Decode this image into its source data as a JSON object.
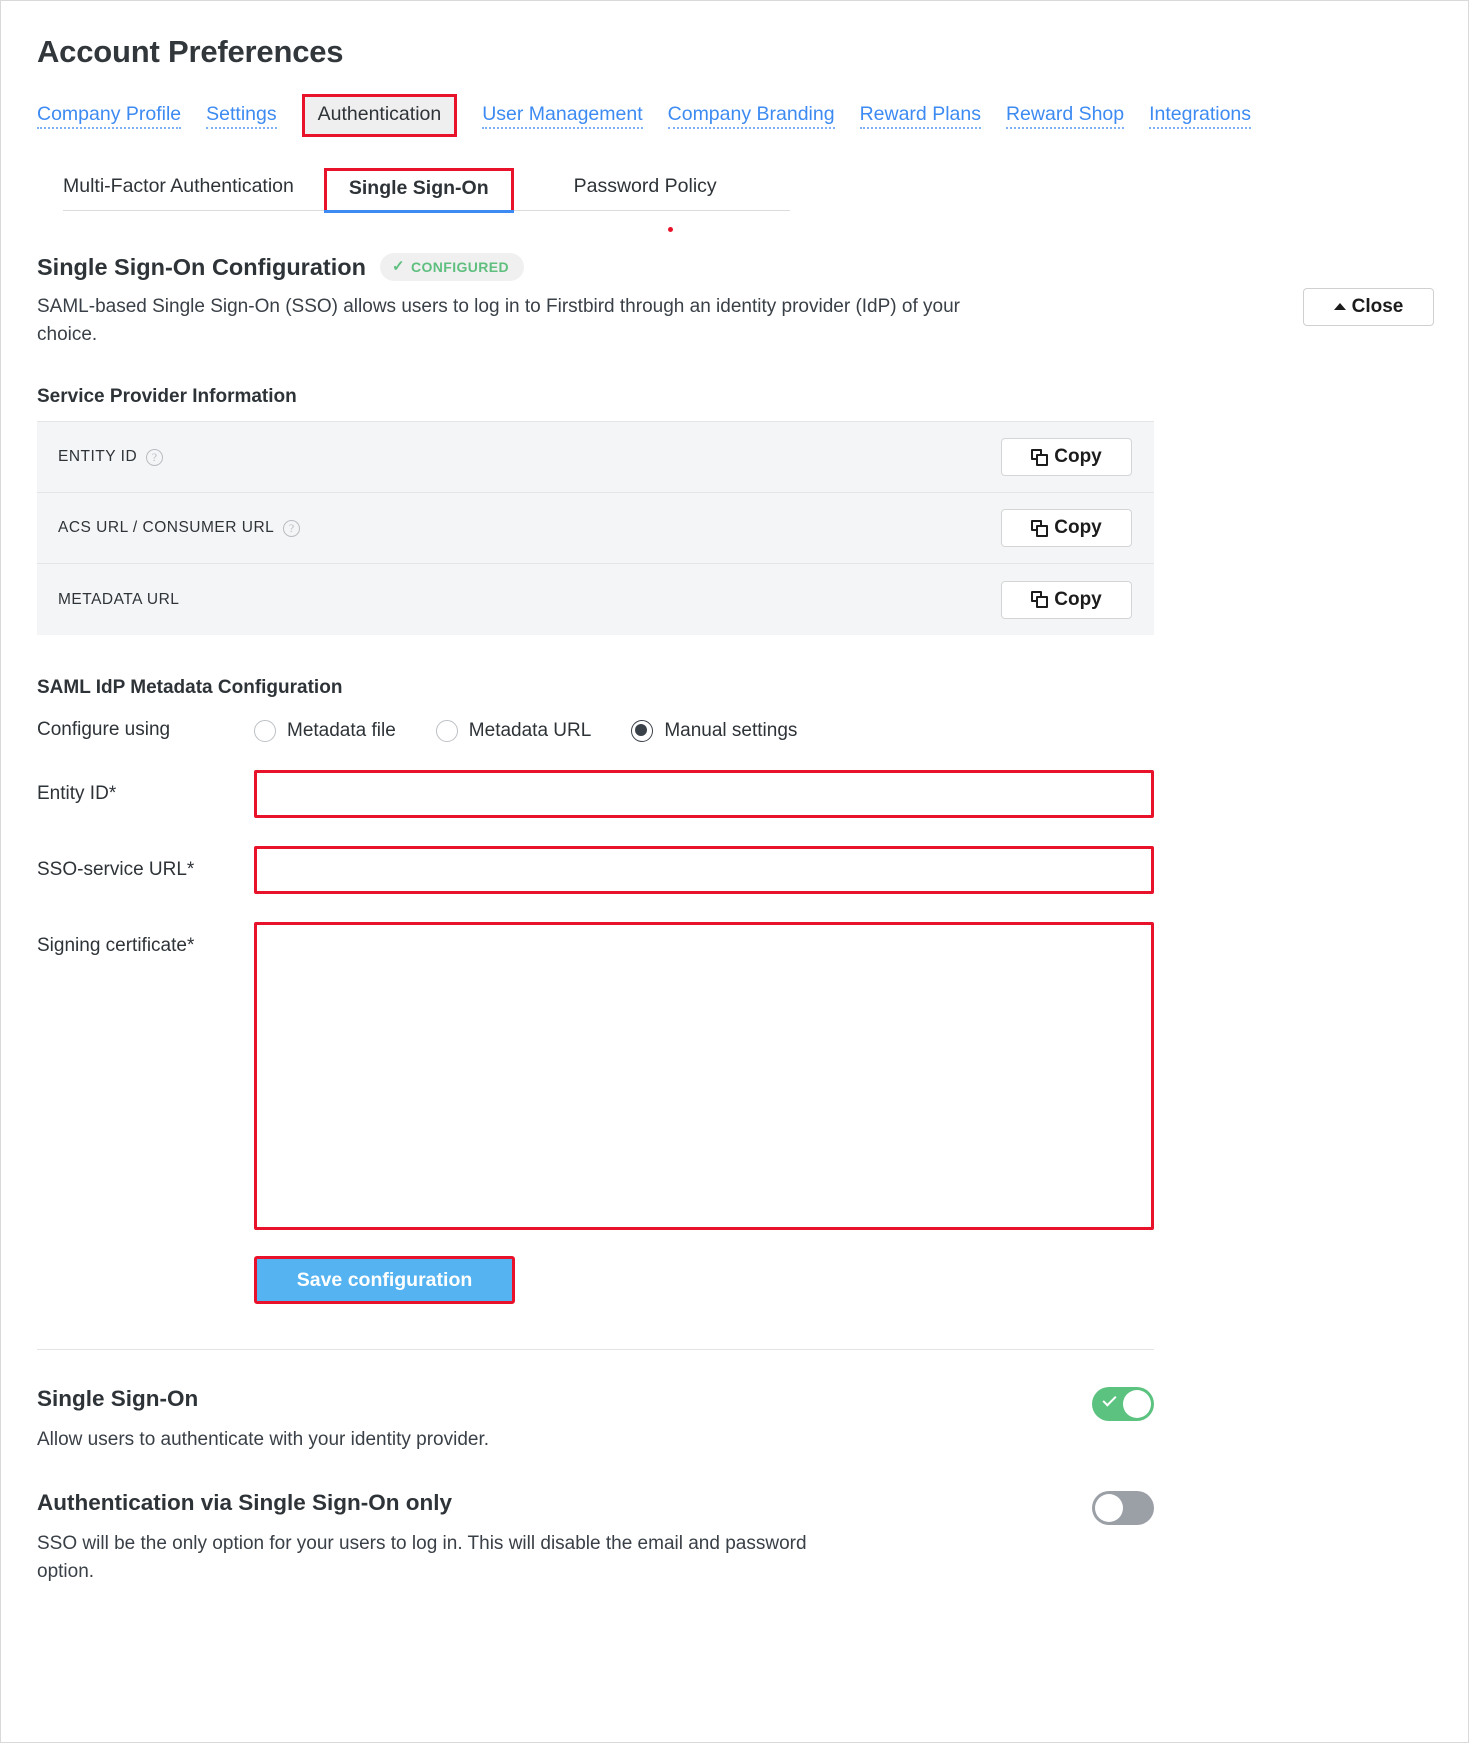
{
  "page": {
    "title": "Account Preferences"
  },
  "topnav": {
    "items": [
      {
        "label": "Company Profile",
        "active": false
      },
      {
        "label": "Settings",
        "active": false
      },
      {
        "label": "Authentication",
        "active": true
      },
      {
        "label": "User Management",
        "active": false
      },
      {
        "label": "Company Branding",
        "active": false
      },
      {
        "label": "Reward Plans",
        "active": false
      },
      {
        "label": "Reward Shop",
        "active": false
      },
      {
        "label": "Integrations",
        "active": false
      }
    ]
  },
  "subtabs": {
    "items": [
      {
        "label": "Multi-Factor Authentication",
        "active": false
      },
      {
        "label": "Single Sign-On",
        "active": true
      },
      {
        "label": "Password Policy",
        "active": false
      }
    ]
  },
  "sso_section": {
    "title": "Single Sign-On Configuration",
    "badge_label": "CONFIGURED",
    "badge_check": "check-icon",
    "badge_color": "#5fbf7f",
    "description": "SAML-based Single Sign-On (SSO) allows users to log in to Firstbird through an identity provider (IdP) of your choice.",
    "close_label": "Close",
    "close_caret": "caret-up-icon"
  },
  "service_provider": {
    "heading": "Service Provider Information",
    "copy_label": "Copy",
    "rows": [
      {
        "label": "ENTITY ID",
        "has_help": true,
        "value": ""
      },
      {
        "label": "ACS URL / CONSUMER URL",
        "has_help": true,
        "value": ""
      },
      {
        "label": "METADATA URL",
        "has_help": false,
        "value": ""
      }
    ]
  },
  "saml_config": {
    "heading": "SAML IdP Metadata Configuration",
    "configure_using_label": "Configure using",
    "options": [
      {
        "label": "Metadata file",
        "selected": false
      },
      {
        "label": "Metadata URL",
        "selected": false
      },
      {
        "label": "Manual settings",
        "selected": true
      }
    ],
    "fields": [
      {
        "label": "Entity ID",
        "required": "*",
        "value": ""
      },
      {
        "label": "SSO-service URL",
        "required": "*",
        "value": ""
      },
      {
        "label": "Signing certificate",
        "required": "*",
        "value": ""
      }
    ],
    "save_label": "Save configuration",
    "save_color": "#54b3f0"
  },
  "toggles": [
    {
      "title": "Single Sign-On",
      "description": "Allow users to authenticate with your identity provider.",
      "state": "on",
      "on_color": "#5bc27f"
    },
    {
      "title": "Authentication via Single Sign-On only",
      "description": "SSO will be the only option for your users to log in. This will disable the email and password option.",
      "state": "off",
      "off_color": "#9b9fa6"
    }
  ],
  "annotation": {
    "highlight_color": "#e8122a"
  }
}
